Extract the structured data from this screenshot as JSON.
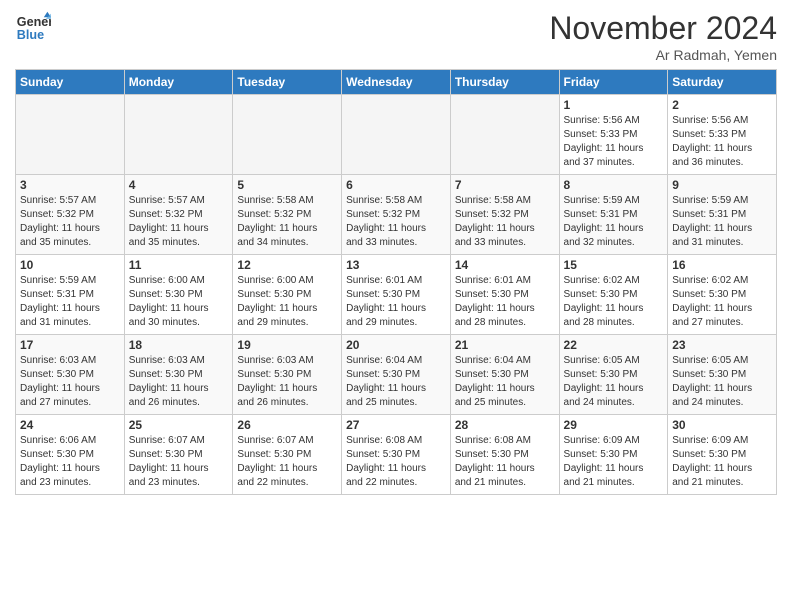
{
  "logo": {
    "line1": "General",
    "line2": "Blue"
  },
  "header": {
    "month": "November 2024",
    "location": "Ar Radmah, Yemen"
  },
  "weekdays": [
    "Sunday",
    "Monday",
    "Tuesday",
    "Wednesday",
    "Thursday",
    "Friday",
    "Saturday"
  ],
  "weeks": [
    [
      {
        "num": "",
        "info": ""
      },
      {
        "num": "",
        "info": ""
      },
      {
        "num": "",
        "info": ""
      },
      {
        "num": "",
        "info": ""
      },
      {
        "num": "",
        "info": ""
      },
      {
        "num": "1",
        "info": "Sunrise: 5:56 AM\nSunset: 5:33 PM\nDaylight: 11 hours\nand 37 minutes."
      },
      {
        "num": "2",
        "info": "Sunrise: 5:56 AM\nSunset: 5:33 PM\nDaylight: 11 hours\nand 36 minutes."
      }
    ],
    [
      {
        "num": "3",
        "info": "Sunrise: 5:57 AM\nSunset: 5:32 PM\nDaylight: 11 hours\nand 35 minutes."
      },
      {
        "num": "4",
        "info": "Sunrise: 5:57 AM\nSunset: 5:32 PM\nDaylight: 11 hours\nand 35 minutes."
      },
      {
        "num": "5",
        "info": "Sunrise: 5:58 AM\nSunset: 5:32 PM\nDaylight: 11 hours\nand 34 minutes."
      },
      {
        "num": "6",
        "info": "Sunrise: 5:58 AM\nSunset: 5:32 PM\nDaylight: 11 hours\nand 33 minutes."
      },
      {
        "num": "7",
        "info": "Sunrise: 5:58 AM\nSunset: 5:32 PM\nDaylight: 11 hours\nand 33 minutes."
      },
      {
        "num": "8",
        "info": "Sunrise: 5:59 AM\nSunset: 5:31 PM\nDaylight: 11 hours\nand 32 minutes."
      },
      {
        "num": "9",
        "info": "Sunrise: 5:59 AM\nSunset: 5:31 PM\nDaylight: 11 hours\nand 31 minutes."
      }
    ],
    [
      {
        "num": "10",
        "info": "Sunrise: 5:59 AM\nSunset: 5:31 PM\nDaylight: 11 hours\nand 31 minutes."
      },
      {
        "num": "11",
        "info": "Sunrise: 6:00 AM\nSunset: 5:30 PM\nDaylight: 11 hours\nand 30 minutes."
      },
      {
        "num": "12",
        "info": "Sunrise: 6:00 AM\nSunset: 5:30 PM\nDaylight: 11 hours\nand 29 minutes."
      },
      {
        "num": "13",
        "info": "Sunrise: 6:01 AM\nSunset: 5:30 PM\nDaylight: 11 hours\nand 29 minutes."
      },
      {
        "num": "14",
        "info": "Sunrise: 6:01 AM\nSunset: 5:30 PM\nDaylight: 11 hours\nand 28 minutes."
      },
      {
        "num": "15",
        "info": "Sunrise: 6:02 AM\nSunset: 5:30 PM\nDaylight: 11 hours\nand 28 minutes."
      },
      {
        "num": "16",
        "info": "Sunrise: 6:02 AM\nSunset: 5:30 PM\nDaylight: 11 hours\nand 27 minutes."
      }
    ],
    [
      {
        "num": "17",
        "info": "Sunrise: 6:03 AM\nSunset: 5:30 PM\nDaylight: 11 hours\nand 27 minutes."
      },
      {
        "num": "18",
        "info": "Sunrise: 6:03 AM\nSunset: 5:30 PM\nDaylight: 11 hours\nand 26 minutes."
      },
      {
        "num": "19",
        "info": "Sunrise: 6:03 AM\nSunset: 5:30 PM\nDaylight: 11 hours\nand 26 minutes."
      },
      {
        "num": "20",
        "info": "Sunrise: 6:04 AM\nSunset: 5:30 PM\nDaylight: 11 hours\nand 25 minutes."
      },
      {
        "num": "21",
        "info": "Sunrise: 6:04 AM\nSunset: 5:30 PM\nDaylight: 11 hours\nand 25 minutes."
      },
      {
        "num": "22",
        "info": "Sunrise: 6:05 AM\nSunset: 5:30 PM\nDaylight: 11 hours\nand 24 minutes."
      },
      {
        "num": "23",
        "info": "Sunrise: 6:05 AM\nSunset: 5:30 PM\nDaylight: 11 hours\nand 24 minutes."
      }
    ],
    [
      {
        "num": "24",
        "info": "Sunrise: 6:06 AM\nSunset: 5:30 PM\nDaylight: 11 hours\nand 23 minutes."
      },
      {
        "num": "25",
        "info": "Sunrise: 6:07 AM\nSunset: 5:30 PM\nDaylight: 11 hours\nand 23 minutes."
      },
      {
        "num": "26",
        "info": "Sunrise: 6:07 AM\nSunset: 5:30 PM\nDaylight: 11 hours\nand 22 minutes."
      },
      {
        "num": "27",
        "info": "Sunrise: 6:08 AM\nSunset: 5:30 PM\nDaylight: 11 hours\nand 22 minutes."
      },
      {
        "num": "28",
        "info": "Sunrise: 6:08 AM\nSunset: 5:30 PM\nDaylight: 11 hours\nand 21 minutes."
      },
      {
        "num": "29",
        "info": "Sunrise: 6:09 AM\nSunset: 5:30 PM\nDaylight: 11 hours\nand 21 minutes."
      },
      {
        "num": "30",
        "info": "Sunrise: 6:09 AM\nSunset: 5:30 PM\nDaylight: 11 hours\nand 21 minutes."
      }
    ]
  ]
}
